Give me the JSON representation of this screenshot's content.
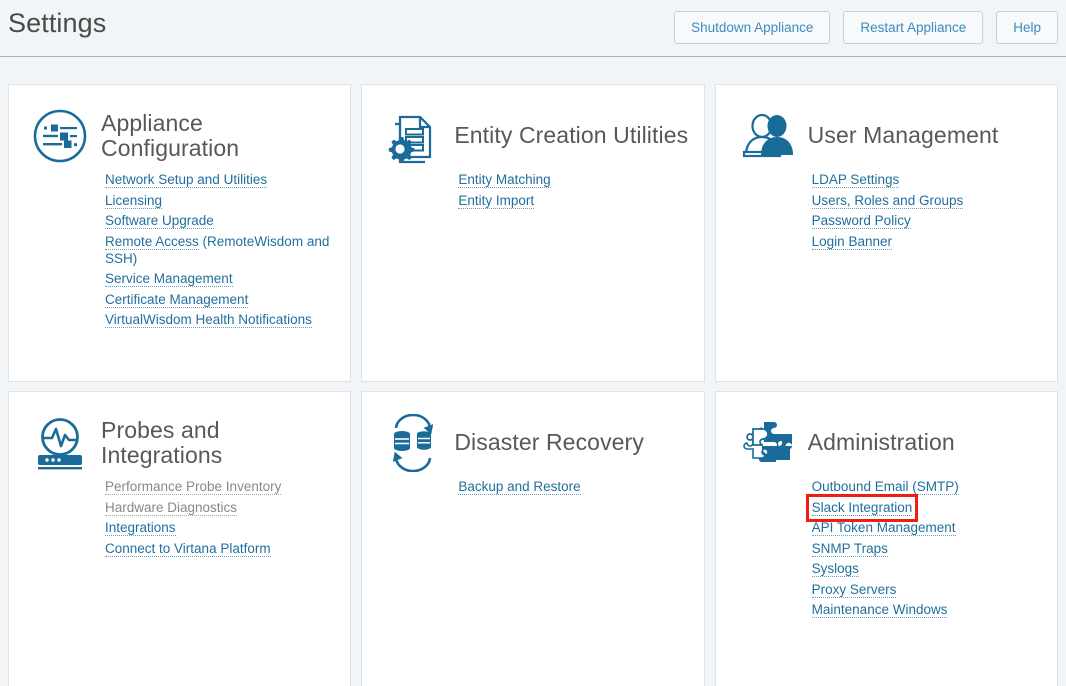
{
  "header": {
    "title": "Settings",
    "buttons": [
      {
        "label": "Shutdown Appliance",
        "name": "shutdown-appliance-button"
      },
      {
        "label": "Restart Appliance",
        "name": "restart-appliance-button"
      },
      {
        "label": "Help",
        "name": "help-button"
      }
    ]
  },
  "colors": {
    "link": "#1f6f9e",
    "link_disabled": "#888888",
    "icon": "#1b6b9a",
    "heading": "#585858",
    "page_background": "#f2f5f7",
    "card_background": "#ffffff",
    "card_border": "#dfe3e8",
    "highlight_outline": "#f01e12",
    "button_text": "#3a8dbd"
  },
  "cards": [
    {
      "title": "Appliance Configuration",
      "icon": "sliders-circle-icon",
      "links": [
        {
          "label": "Network Setup and Utilities",
          "disabled": false,
          "suffix": ""
        },
        {
          "label": "Licensing",
          "disabled": false,
          "suffix": ""
        },
        {
          "label": "Software Upgrade",
          "disabled": false,
          "suffix": ""
        },
        {
          "label": "Remote Access",
          "disabled": false,
          "suffix": " (RemoteWisdom and SSH)"
        },
        {
          "label": "Service Management",
          "disabled": false,
          "suffix": ""
        },
        {
          "label": "Certificate Management",
          "disabled": false,
          "suffix": ""
        },
        {
          "label": "VirtualWisdom Health Notifications",
          "disabled": false,
          "suffix": ""
        }
      ]
    },
    {
      "title": "Entity Creation Utilities",
      "icon": "document-gear-icon",
      "links": [
        {
          "label": "Entity Matching",
          "disabled": false,
          "suffix": ""
        },
        {
          "label": "Entity Import",
          "disabled": false,
          "suffix": ""
        }
      ]
    },
    {
      "title": "User Management",
      "icon": "users-icon",
      "links": [
        {
          "label": "LDAP Settings",
          "disabled": false,
          "suffix": ""
        },
        {
          "label": "Users, Roles and Groups",
          "disabled": false,
          "suffix": ""
        },
        {
          "label": "Password Policy",
          "disabled": false,
          "suffix": ""
        },
        {
          "label": "Login Banner",
          "disabled": false,
          "suffix": ""
        }
      ]
    },
    {
      "title": "Probes and Integrations",
      "icon": "probe-monitor-icon",
      "links": [
        {
          "label": "Performance Probe Inventory",
          "disabled": true,
          "suffix": ""
        },
        {
          "label": "Hardware Diagnostics",
          "disabled": true,
          "suffix": ""
        },
        {
          "label": "Integrations",
          "disabled": false,
          "suffix": ""
        },
        {
          "label": "Connect to Virtana Platform",
          "disabled": false,
          "suffix": ""
        }
      ]
    },
    {
      "title": "Disaster Recovery",
      "icon": "database-sync-icon",
      "links": [
        {
          "label": "Backup and Restore",
          "disabled": false,
          "suffix": ""
        }
      ]
    },
    {
      "title": "Administration",
      "icon": "puzzle-pieces-icon",
      "links": [
        {
          "label": "Outbound Email (SMTP)",
          "disabled": false,
          "suffix": ""
        },
        {
          "label": "Slack Integration",
          "disabled": false,
          "suffix": "",
          "highlighted": true
        },
        {
          "label": "API Token Management",
          "disabled": false,
          "suffix": ""
        },
        {
          "label": "SNMP Traps",
          "disabled": false,
          "suffix": ""
        },
        {
          "label": "Syslogs",
          "disabled": false,
          "suffix": ""
        },
        {
          "label": "Proxy Servers",
          "disabled": false,
          "suffix": ""
        },
        {
          "label": "Maintenance Windows",
          "disabled": false,
          "suffix": ""
        }
      ]
    }
  ]
}
